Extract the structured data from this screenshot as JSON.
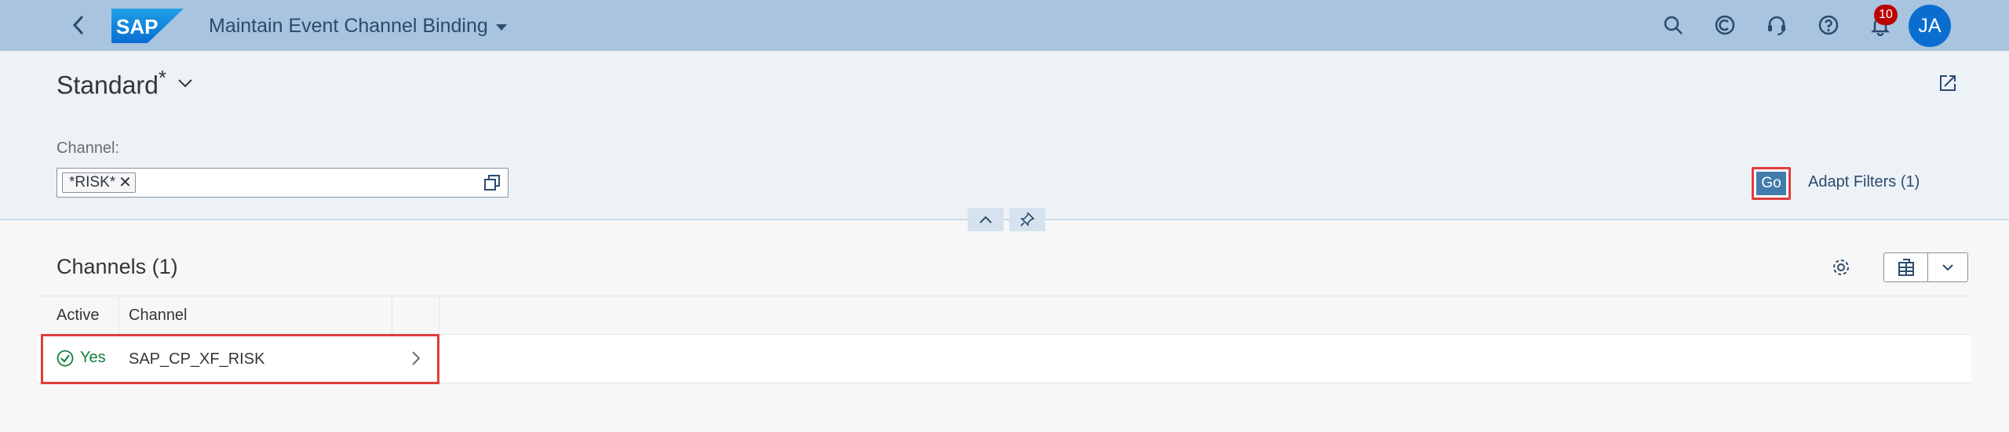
{
  "shell": {
    "app_title": "Maintain Event Channel Binding",
    "logo_text": "SAP",
    "notification_count": "10",
    "avatar_initials": "JA",
    "icons": [
      "back-icon",
      "search-icon",
      "copilot-icon",
      "headset-icon",
      "help-icon",
      "bell-icon"
    ]
  },
  "filter_bar": {
    "variant_name": "Standard",
    "variant_dirty_marker": "*",
    "channel_label": "Channel:",
    "channel_token": "*RISK*",
    "token_remove": "✕",
    "go_label": "Go",
    "adapt_filters_label": "Adapt Filters (1)"
  },
  "table": {
    "title": "Channels (1)",
    "columns": [
      "Active",
      "Channel"
    ],
    "rows": [
      {
        "active": "Yes",
        "channel": "SAP_CP_XF_RISK"
      }
    ]
  },
  "colors": {
    "shell_bg": "#a8c4df",
    "header_bg": "#edf2f7",
    "accent": "#427cac",
    "highlight": "#e03c3c",
    "positive": "#107e3e",
    "badge": "#bb0000"
  }
}
